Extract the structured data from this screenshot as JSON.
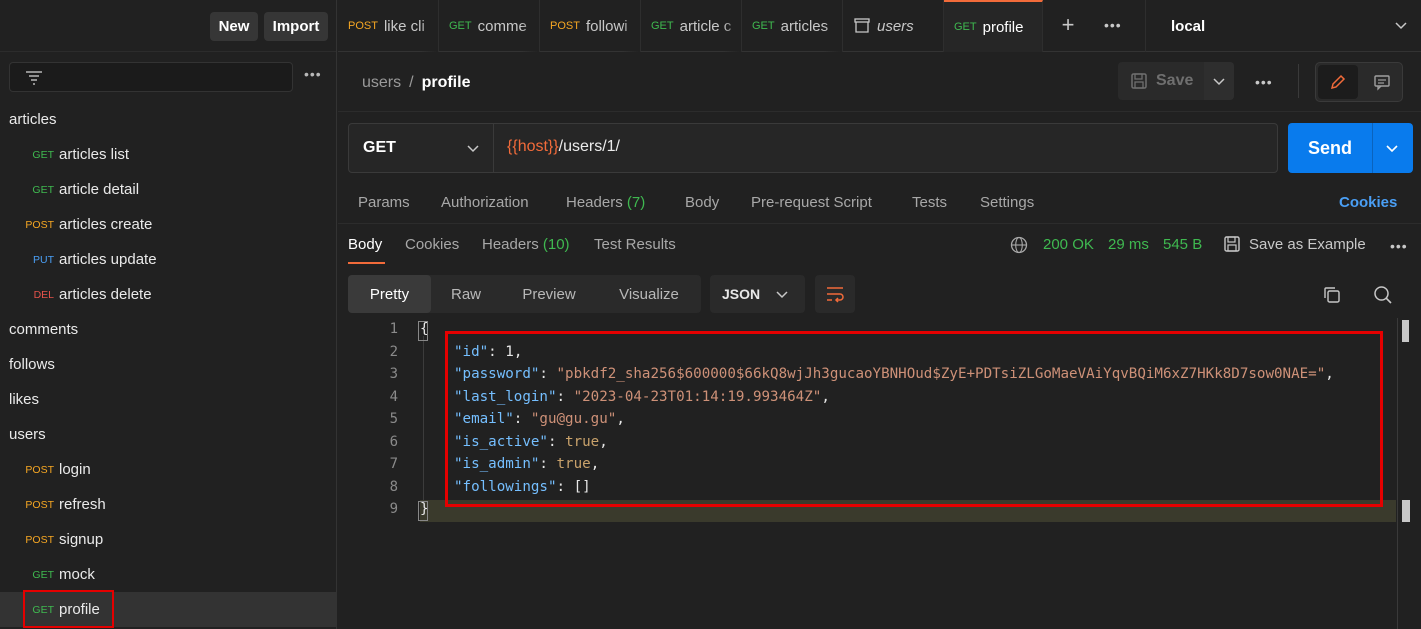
{
  "sidebar": {
    "new_label": "New",
    "import_label": "Import",
    "more_label": "•••",
    "tree": [
      {
        "type": "folder",
        "label": "articles"
      },
      {
        "type": "req",
        "method": "GET",
        "label": "articles list"
      },
      {
        "type": "req",
        "method": "GET",
        "label": "article detail"
      },
      {
        "type": "req",
        "method": "POST",
        "label": "articles create"
      },
      {
        "type": "req",
        "method": "PUT",
        "label": "articles update"
      },
      {
        "type": "req",
        "method": "DEL",
        "label": "articles delete"
      },
      {
        "type": "folder",
        "label": "comments"
      },
      {
        "type": "folder",
        "label": "follows"
      },
      {
        "type": "folder",
        "label": "likes"
      },
      {
        "type": "folder",
        "label": "users"
      },
      {
        "type": "req",
        "method": "POST",
        "label": "login"
      },
      {
        "type": "req",
        "method": "POST",
        "label": "refresh"
      },
      {
        "type": "req",
        "method": "POST",
        "label": "signup"
      },
      {
        "type": "req",
        "method": "GET",
        "label": "mock"
      },
      {
        "type": "req",
        "method": "GET",
        "label": "profile",
        "active": true
      }
    ]
  },
  "tabs": [
    {
      "method": "POST",
      "label": "like cli"
    },
    {
      "method": "GET",
      "label": "comme"
    },
    {
      "method": "POST",
      "label": "followi"
    },
    {
      "method": "GET",
      "label": "article c"
    },
    {
      "method": "GET",
      "label": "articles"
    },
    {
      "method": "",
      "label": "users",
      "icon": "collection-icon"
    },
    {
      "method": "GET",
      "label": "profile",
      "active": true
    }
  ],
  "tab_more": "•••",
  "environment": "local",
  "breadcrumb": {
    "parent": "users",
    "sep": "/",
    "current": "profile"
  },
  "toolbar": {
    "save_label": "Save",
    "more_label": "•••"
  },
  "request": {
    "method": "GET",
    "url_var": "{{host}}",
    "url_path": "/users/1/",
    "send_label": "Send"
  },
  "request_tabs": {
    "params": "Params",
    "authorization": "Authorization",
    "headers": "Headers",
    "headers_count": "(7)",
    "body": "Body",
    "prerequest": "Pre-request Script",
    "tests": "Tests",
    "settings": "Settings",
    "cookies": "Cookies"
  },
  "response_tabs": {
    "body": "Body",
    "cookies": "Cookies",
    "headers": "Headers",
    "headers_count": "(10)",
    "test_results": "Test Results",
    "status": "200 OK",
    "time": "29 ms",
    "size": "545 B",
    "save_example": "Save as Example",
    "more_label": "•••"
  },
  "format": {
    "pretty": "Pretty",
    "raw": "Raw",
    "preview": "Preview",
    "visualize": "Visualize",
    "language": "JSON"
  },
  "response_body": {
    "line_numbers": [
      "1",
      "2",
      "3",
      "4",
      "5",
      "6",
      "7",
      "8",
      "9"
    ],
    "open_brace": "{",
    "close_brace": "}",
    "fields": [
      {
        "key": "\"id\"",
        "value": "1",
        "kind": "num"
      },
      {
        "key": "\"password\"",
        "value": "\"pbkdf2_sha256$600000$66kQ8wjJh3gucaoYBNHOud$ZyE+PDTsiZLGoMaeVAiYqvBQiM6xZ7HKk8D7sow0NAE=\"",
        "kind": "str"
      },
      {
        "key": "\"last_login\"",
        "value": "\"2023-04-23T01:14:19.993464Z\"",
        "kind": "str"
      },
      {
        "key": "\"email\"",
        "value": "\"gu@gu.gu\"",
        "kind": "str"
      },
      {
        "key": "\"is_active\"",
        "value": "true",
        "kind": "kw"
      },
      {
        "key": "\"is_admin\"",
        "value": "true",
        "kind": "kw"
      },
      {
        "key": "\"followings\"",
        "value": "[]",
        "kind": "num",
        "last": true
      }
    ]
  },
  "colors": {
    "accent": "#f26b3a",
    "send": "#097bed",
    "get": "#3fb950",
    "post": "#f5a623",
    "put": "#4a9ff5",
    "delete": "#e5534b",
    "highlight_box": "#e50000"
  }
}
